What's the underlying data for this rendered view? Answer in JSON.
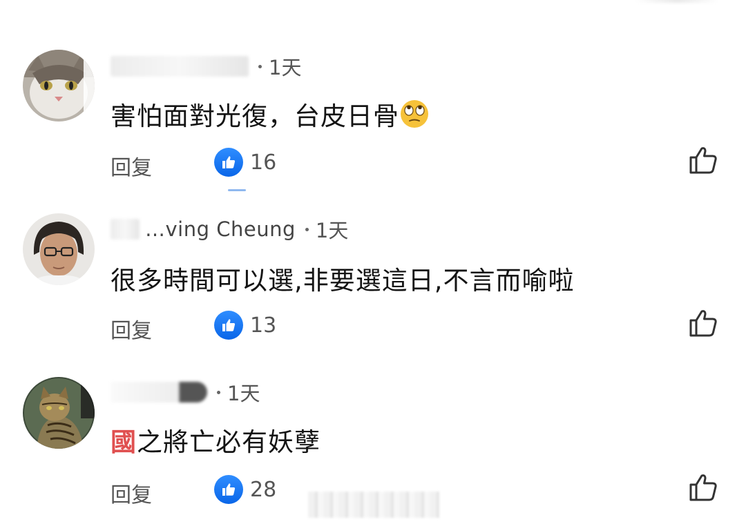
{
  "comments": [
    {
      "author": "",
      "time": "1天",
      "text": "害怕面對光復，台皮日骨",
      "emoji": "rolling-eyes-emoji",
      "reply_label": "回复",
      "likes": "16"
    },
    {
      "author": "…ving Cheung",
      "time": "1天",
      "text": "很多時間可以選,非要選這日,不言而喻啦",
      "reply_label": "回复",
      "likes": "13"
    },
    {
      "author": "",
      "time": "1天",
      "text_prefix": "國",
      "text": "之將亡必有妖孽",
      "reply_label": "回复",
      "likes": "28"
    }
  ],
  "icons": {
    "like_badge": "thumbs-up-icon",
    "like_button": "thumbs-up-outline-icon"
  },
  "colors": {
    "like_blue": "#1877f2",
    "highlight_red": "#e05050"
  }
}
